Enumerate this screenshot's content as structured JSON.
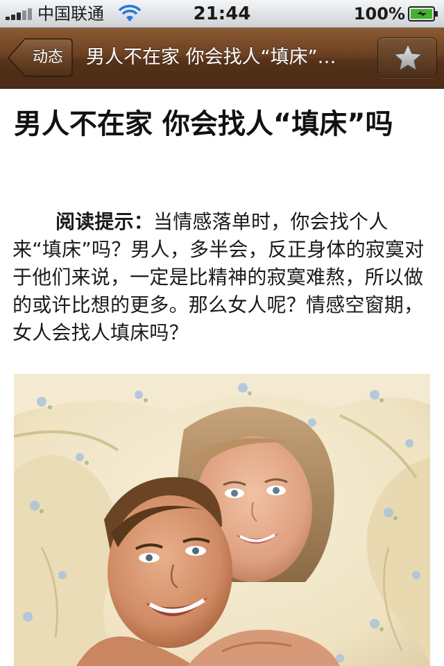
{
  "status_bar": {
    "carrier": "中国联通",
    "time": "21:44",
    "battery_percent": "100%",
    "signal_icon": "signal-bars-icon",
    "wifi_icon": "wifi-icon",
    "battery_icon": "battery-charging-icon"
  },
  "nav": {
    "back_label": "动态",
    "title": "男人不在家 你会找人“填床”…",
    "favorite_icon": "star-icon",
    "bar_color": "#6b4122"
  },
  "article": {
    "title": "男人不在家 你会找人“填床”吗",
    "lead_label": "阅读提示：",
    "lead_text": "当情感落单时，你会找个人来“填床”吗？男人，多半会，反正身体的寂寞对于他们来说，一定是比精神的寂寞难熬，所以做的或许比想的更多。那么女人呢？情感空窗期，女人会找人填床吗？",
    "photo_icon": "couple-photo"
  }
}
